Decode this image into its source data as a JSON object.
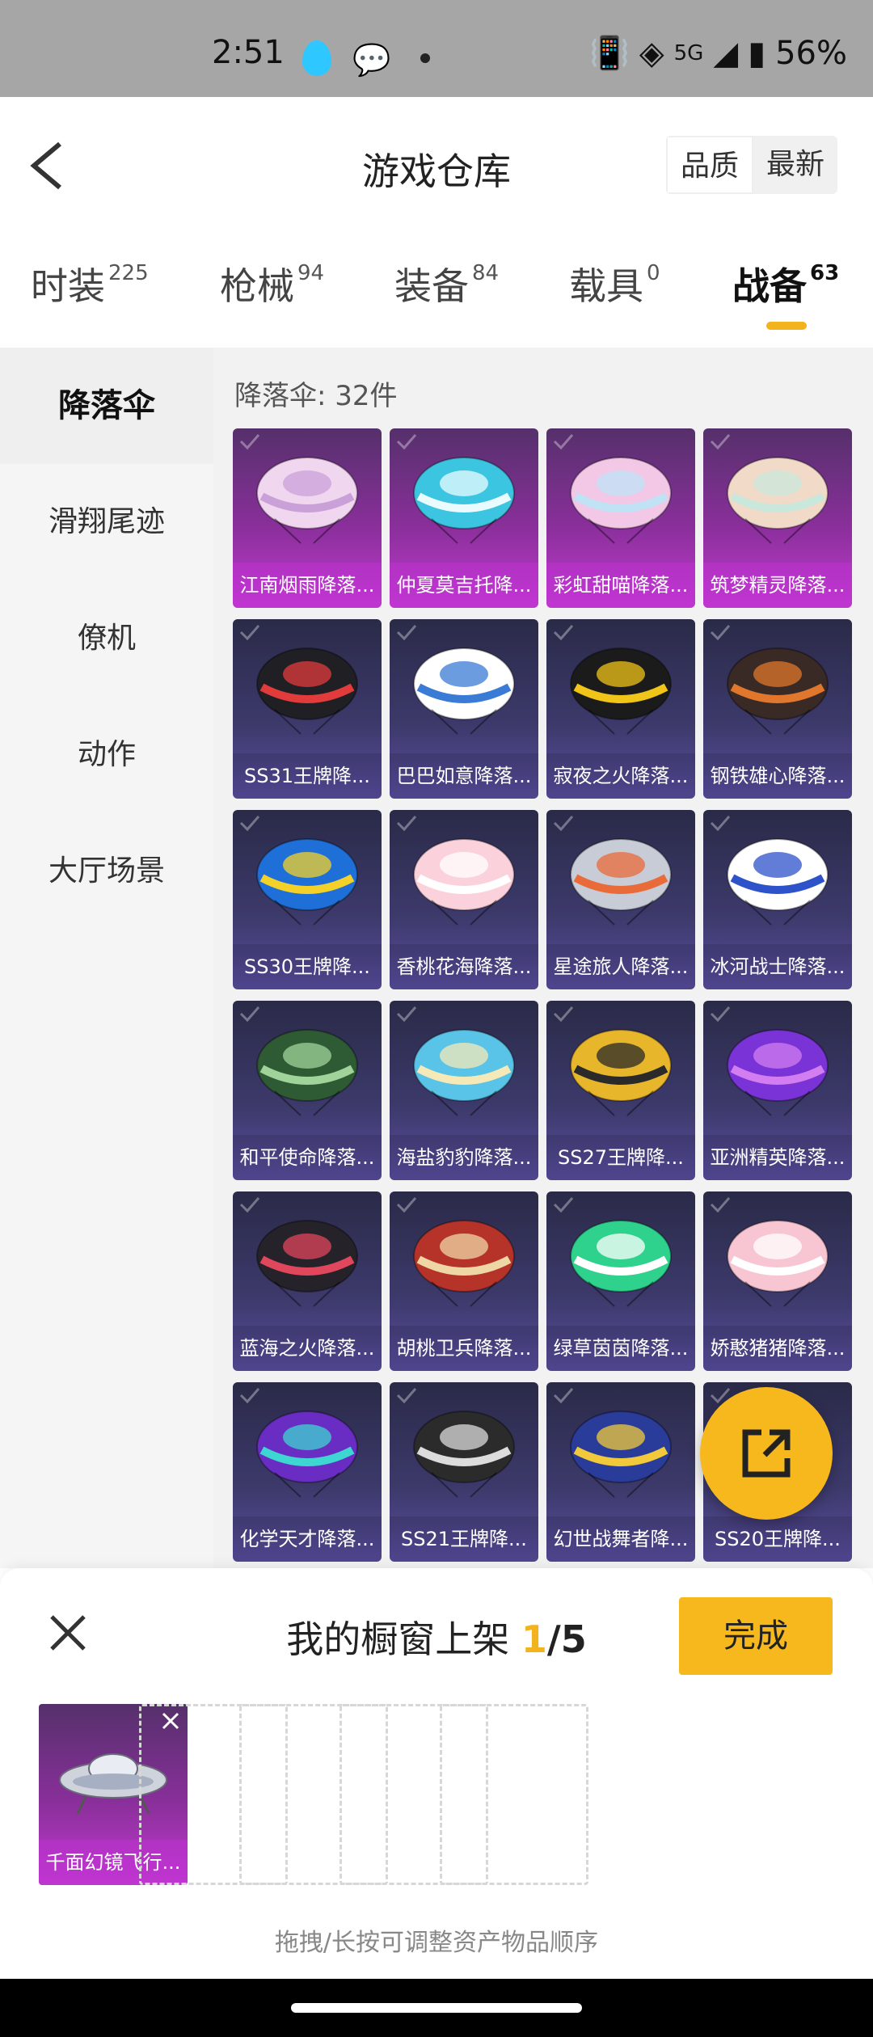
{
  "status_bar": {
    "time": "2:51",
    "network": "5G",
    "battery": "56%"
  },
  "header": {
    "title": "游戏仓库",
    "sort_options": [
      "品质",
      "最新"
    ],
    "sort_active": "品质"
  },
  "tabs": [
    {
      "label": "时装",
      "count": "225"
    },
    {
      "label": "枪械",
      "count": "94"
    },
    {
      "label": "装备",
      "count": "84"
    },
    {
      "label": "载具",
      "count": "0"
    },
    {
      "label": "战备",
      "count": "63",
      "active": true
    }
  ],
  "sidebar": {
    "items": [
      "降落伞",
      "滑翔尾迹",
      "僚机",
      "动作",
      "大厅场景"
    ],
    "active": "降落伞"
  },
  "content": {
    "count_label": "降落伞: 32件",
    "items": [
      {
        "name": "江南烟雨降落...",
        "tier": "purple",
        "colors": [
          "#f0d6ee",
          "#c9a0d8"
        ]
      },
      {
        "name": "仲夏莫吉托降...",
        "tier": "purple",
        "colors": [
          "#3cc5e0",
          "#e9fbff"
        ]
      },
      {
        "name": "彩虹甜喵降落...",
        "tier": "purple",
        "colors": [
          "#f3c7e6",
          "#bfe3f5"
        ]
      },
      {
        "name": "筑梦精灵降落...",
        "tier": "purple",
        "colors": [
          "#f2dac9",
          "#c9e7da"
        ]
      },
      {
        "name": "SS31王牌降...",
        "tier": "blue",
        "colors": [
          "#1f1f24",
          "#e23b3b"
        ]
      },
      {
        "name": "巴巴如意降落...",
        "tier": "blue",
        "colors": [
          "#ffffff",
          "#3a7bd5"
        ]
      },
      {
        "name": "寂夜之火降落...",
        "tier": "blue",
        "colors": [
          "#1b1b1b",
          "#f0c419"
        ]
      },
      {
        "name": "钢铁雄心降落...",
        "tier": "blue",
        "colors": [
          "#3a2a26",
          "#e0772c"
        ]
      },
      {
        "name": "SS30王牌降...",
        "tier": "blue",
        "colors": [
          "#1f6fd8",
          "#f4d128"
        ]
      },
      {
        "name": "香桃花海降落...",
        "tier": "blue",
        "colors": [
          "#fbd2dc",
          "#ffffff"
        ]
      },
      {
        "name": "星途旅人降落...",
        "tier": "blue",
        "colors": [
          "#c8ccd6",
          "#ea6b3a"
        ]
      },
      {
        "name": "冰河战士降落...",
        "tier": "blue",
        "colors": [
          "#ffffff",
          "#2d52c9"
        ]
      },
      {
        "name": "和平使命降落...",
        "tier": "blue",
        "colors": [
          "#2e5b33",
          "#9fd39a"
        ]
      },
      {
        "name": "海盐豹豹降落...",
        "tier": "blue",
        "colors": [
          "#59c3e8",
          "#f5e9b8"
        ]
      },
      {
        "name": "SS27王牌降...",
        "tier": "blue",
        "colors": [
          "#e8b62b",
          "#2a2a2a"
        ]
      },
      {
        "name": "亚洲精英降落...",
        "tier": "blue",
        "colors": [
          "#7a33d6",
          "#d27df0"
        ]
      },
      {
        "name": "蓝海之火降落...",
        "tier": "blue",
        "colors": [
          "#262229",
          "#e0465c"
        ]
      },
      {
        "name": "胡桃卫兵降落...",
        "tier": "blue",
        "colors": [
          "#b6332a",
          "#efd7a5"
        ]
      },
      {
        "name": "绿草茵茵降落...",
        "tier": "blue",
        "colors": [
          "#2fd28d",
          "#ffffff"
        ]
      },
      {
        "name": "娇憨猪猪降落...",
        "tier": "blue",
        "colors": [
          "#f7c6d2",
          "#ffffff"
        ]
      },
      {
        "name": "化学天才降落...",
        "tier": "blue",
        "colors": [
          "#6a2dc4",
          "#3dd6d0"
        ]
      },
      {
        "name": "SS21王牌降...",
        "tier": "blue",
        "colors": [
          "#2b2b2b",
          "#dcdcdc"
        ]
      },
      {
        "name": "幻世战舞者降...",
        "tier": "blue",
        "colors": [
          "#2a3c9a",
          "#f1c93a"
        ]
      },
      {
        "name": "SS20王牌降...",
        "tier": "blue",
        "colors": [
          "#d14b3a",
          "#f0c83a"
        ]
      }
    ]
  },
  "fab": {
    "icon": "share-icon"
  },
  "showcase": {
    "title": "我的橱窗上架",
    "current": "1",
    "total": "/5",
    "done_label": "完成",
    "hint": "拖拽/长按可调整资产物品顺序",
    "slots": [
      {
        "name": "千面幻镜飞行...",
        "filled": true
      },
      {
        "filled": false
      },
      {
        "filled": false
      },
      {
        "filled": false
      },
      {
        "filled": false
      }
    ]
  },
  "theme": {
    "accent": "#f7b81e",
    "purple_tier": "#a534b8",
    "blue_tier": "#4a3f8a"
  }
}
